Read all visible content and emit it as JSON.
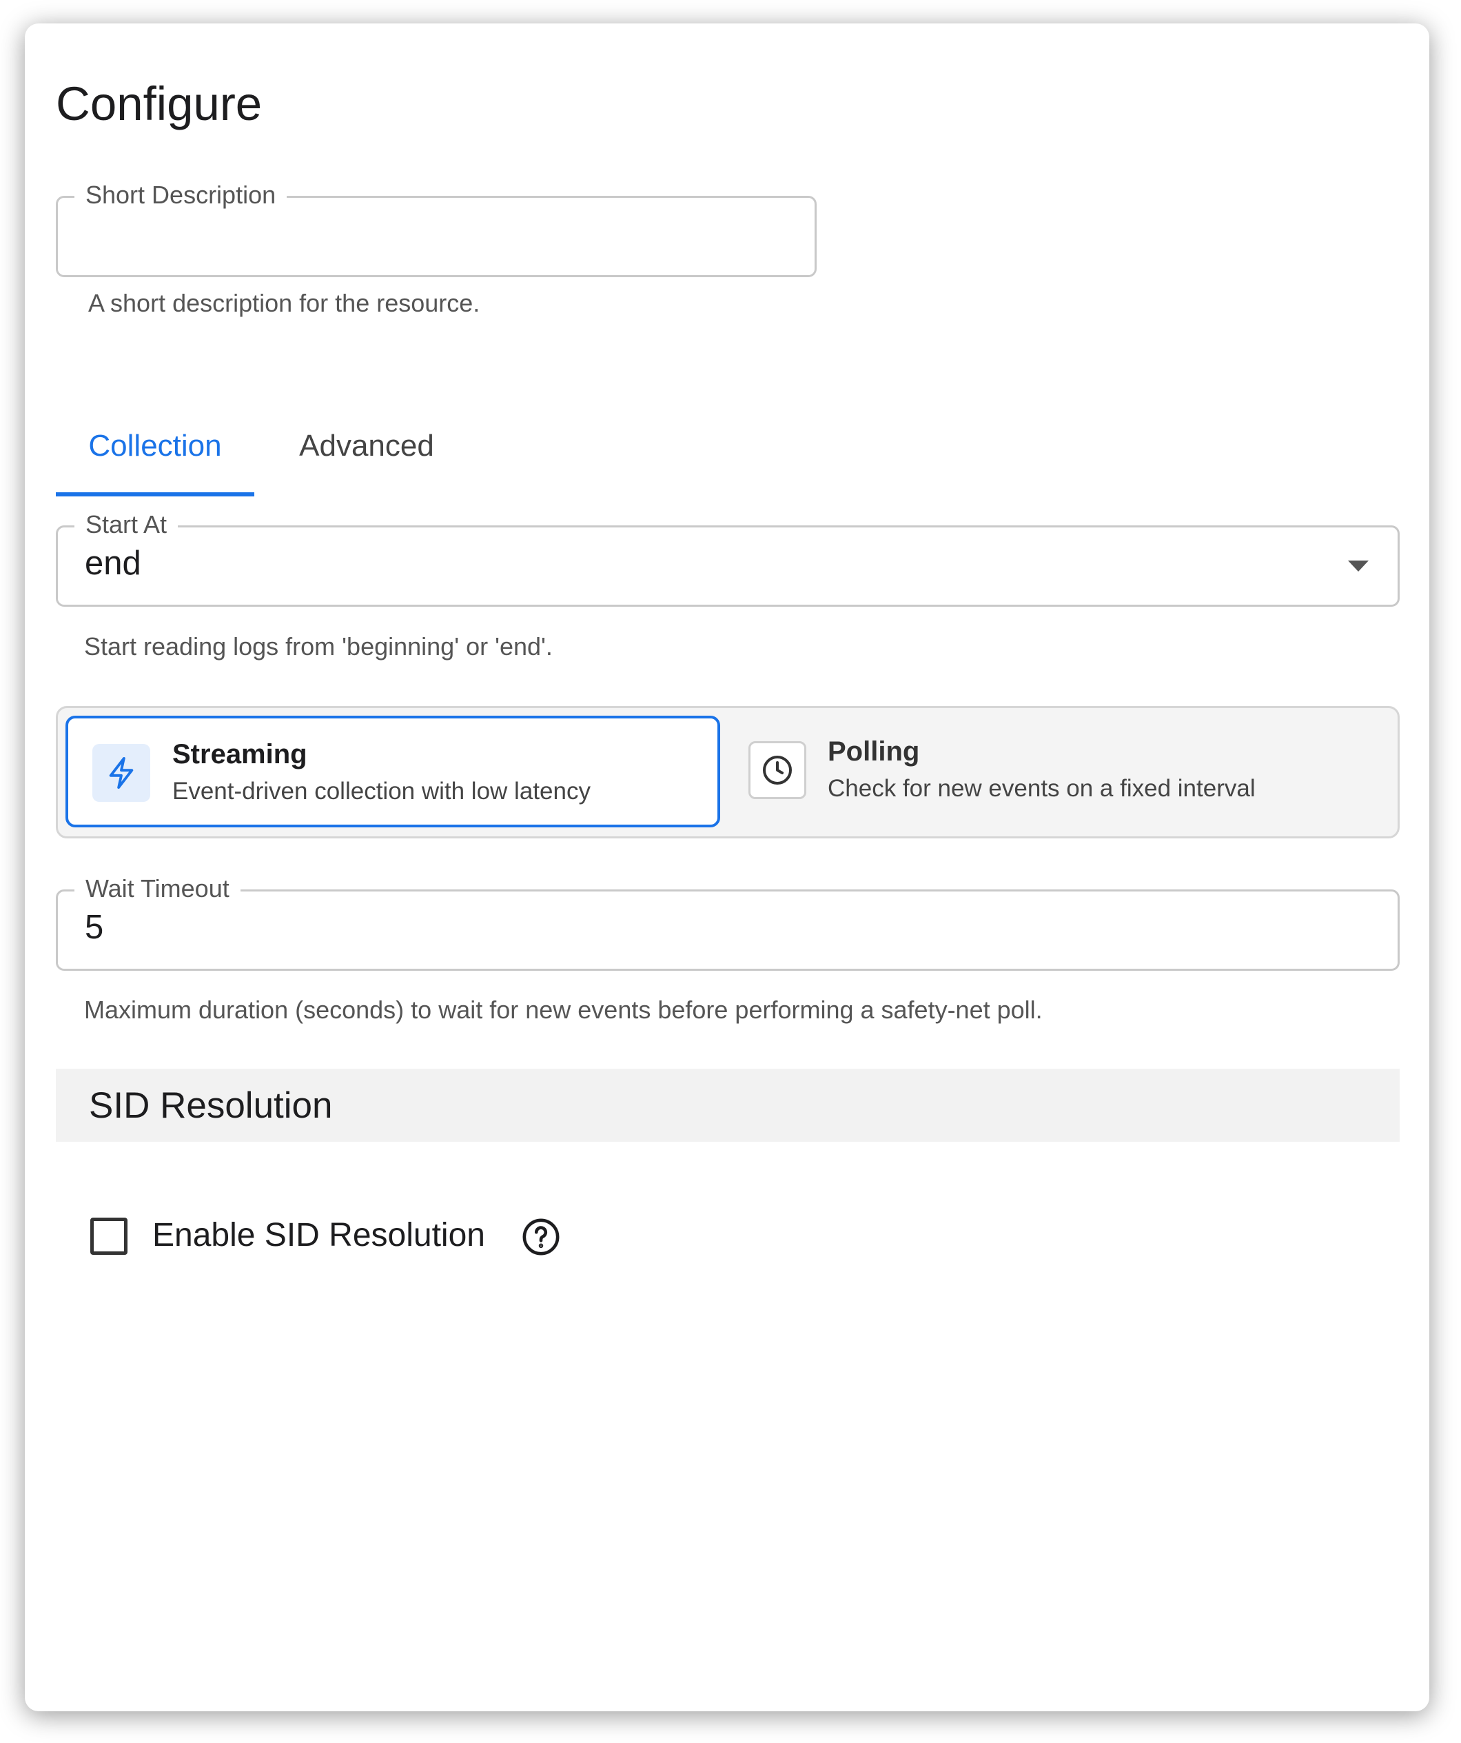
{
  "page": {
    "title": "Configure"
  },
  "short_description": {
    "label": "Short Description",
    "value": "",
    "helper": "A short description for the resource."
  },
  "tabs": [
    {
      "label": "Collection",
      "active": true
    },
    {
      "label": "Advanced",
      "active": false
    }
  ],
  "start_at": {
    "label": "Start At",
    "value": "end",
    "helper": "Start reading logs from 'beginning' or 'end'.",
    "icon": "dropdown-caret-icon"
  },
  "collection_mode": {
    "selected": "Streaming",
    "options": [
      {
        "title": "Streaming",
        "description": "Event-driven collection with low latency",
        "icon": "lightning-icon"
      },
      {
        "title": "Polling",
        "description": "Check for new events on a fixed interval",
        "icon": "clock-icon"
      }
    ]
  },
  "wait_timeout": {
    "label": "Wait Timeout",
    "value": "5",
    "helper": "Maximum duration (seconds) to wait for new events before performing a safety-net poll."
  },
  "sid_resolution": {
    "section_title": "SID Resolution",
    "checkbox_label": "Enable SID Resolution",
    "checked": false,
    "help_icon": "help-circle-icon"
  },
  "colors": {
    "accent": "#1a73e8",
    "text": "#1d1d1f",
    "muted": "#555555",
    "border": "#c9c9c9",
    "section_bg": "#f2f2f2"
  }
}
